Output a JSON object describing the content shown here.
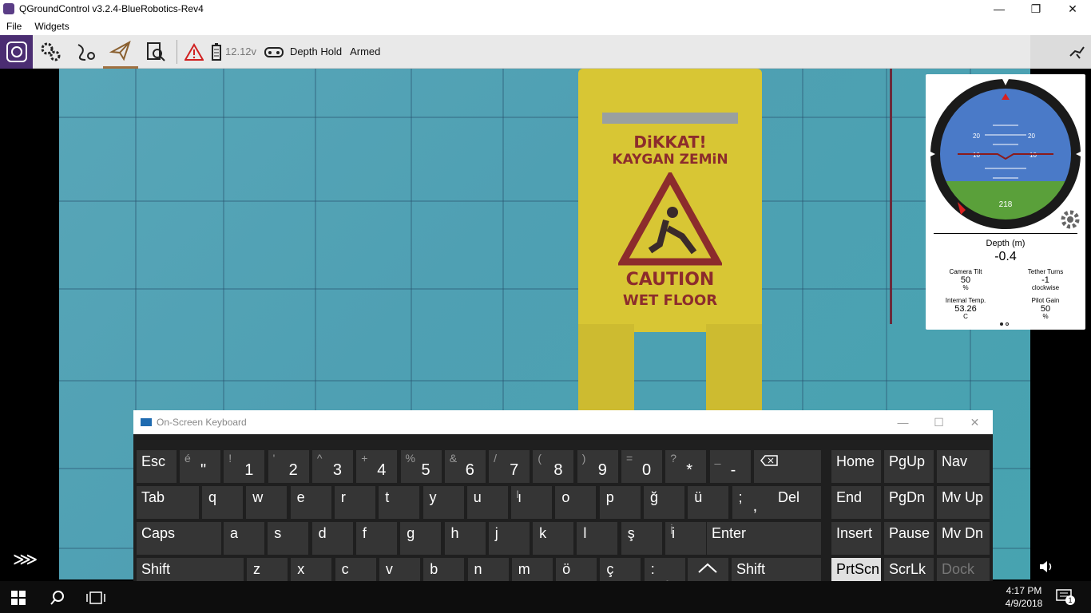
{
  "window": {
    "title": "QGroundControl v3.2.4-BlueRobotics-Rev4",
    "minimize": "—",
    "maximize": "❐",
    "close": "✕"
  },
  "menu": {
    "file": "File",
    "widgets": "Widgets"
  },
  "toolbar": {
    "voltage": "12.12v",
    "mode": "Depth Hold",
    "armed": "Armed"
  },
  "sign": {
    "line1": "DiKKAT!",
    "line2": "KAYGAN ZEMiN",
    "line3": "CAUTION",
    "line4": "WET FLOOR"
  },
  "attitude": {
    "heading": "218",
    "pitch_labels": [
      "20",
      "20",
      "10",
      "10"
    ]
  },
  "instrument": {
    "depth_label": "Depth (m)",
    "depth_value": "-0.4",
    "camera_tilt": {
      "label": "Camera Tilt",
      "value": "50",
      "unit": "%"
    },
    "tether_turns": {
      "label": "Tether Turns",
      "value": "-1",
      "unit": "clockwise"
    },
    "internal_temp": {
      "label": "Internal Temp.",
      "value": "53.26",
      "unit": "C"
    },
    "pilot_gain": {
      "label": "Pilot Gain",
      "value": "50",
      "unit": "%"
    }
  },
  "osk": {
    "title": "On-Screen Keyboard",
    "keys": {
      "esc": "Esc",
      "tab": "Tab",
      "caps": "Caps",
      "shift": "Shift",
      "enter": "Enter",
      "del": "Del",
      "home": "Home",
      "pgup": "PgUp",
      "nav": "Nav",
      "end": "End",
      "pgdn": "PgDn",
      "mvup": "Mv Up",
      "insert": "Insert",
      "pause": "Pause",
      "mvdn": "Mv Dn",
      "prtscn": "PrtScn",
      "scrlk": "ScrLk",
      "dock": "Dock",
      "r1": [
        [
          "é",
          "\""
        ],
        [
          "!",
          "1"
        ],
        [
          "'",
          "2"
        ],
        [
          "^",
          "3"
        ],
        [
          "+",
          "4"
        ],
        [
          "%",
          "5"
        ],
        [
          "&",
          "6"
        ],
        [
          "/",
          "7"
        ],
        [
          "(",
          "8"
        ],
        [
          ")",
          "9"
        ],
        [
          "=",
          "0"
        ],
        [
          "?",
          "*"
        ],
        [
          "_",
          "-"
        ]
      ],
      "r2": [
        "q",
        "w",
        "e",
        "r",
        "t",
        "y",
        "u",
        "ı",
        "o",
        "p",
        "ğ",
        "ü",
        ";"
      ],
      "r2sub": [
        "",
        "",
        "",
        "",
        "",
        "",
        "",
        "",
        "",
        "",
        "",
        "",
        ","
      ],
      "r2hint": [
        "",
        "",
        "",
        "",
        "",
        "",
        "",
        "I",
        "",
        "",
        "",
        "",
        ""
      ],
      "r3": [
        "a",
        "s",
        "d",
        "f",
        "g",
        "h",
        "j",
        "k",
        "l",
        "ş",
        "i"
      ],
      "r3hint": [
        "",
        "",
        "",
        "",
        "",
        "",
        "",
        "",
        "",
        "",
        "İ"
      ],
      "r4": [
        "z",
        "x",
        "c",
        "v",
        "b",
        "n",
        "m",
        "ö",
        "ç",
        ":"
      ],
      "r4sub": [
        "",
        "",
        "",
        "",
        "",
        "",
        "",
        "",
        "",
        "."
      ]
    }
  },
  "taskbar": {
    "time": "4:17 PM",
    "date": "4/9/2018",
    "notif": "1"
  },
  "colors": {
    "accent": "#4b2d72",
    "keybg": "#353535"
  }
}
